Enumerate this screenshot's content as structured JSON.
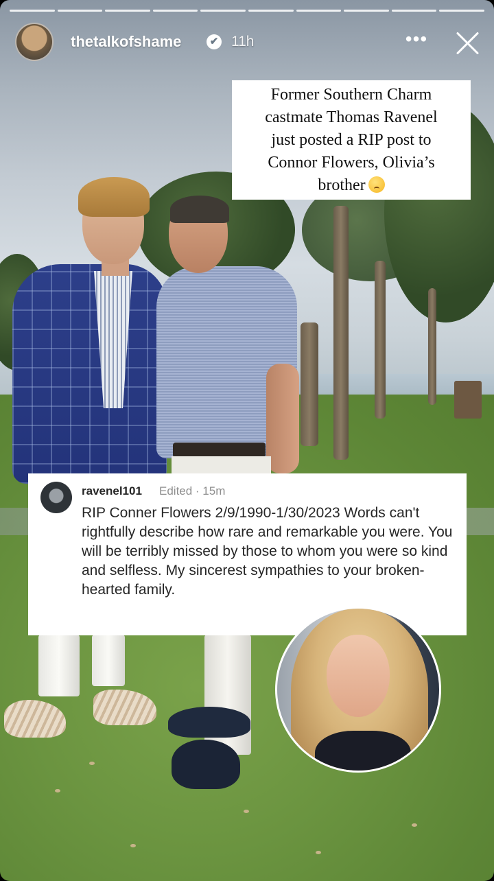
{
  "story": {
    "username": "thetalkofshame",
    "verified_badge": "✔",
    "time_ago": "11h",
    "more_label": "•••",
    "progress_segments": 10,
    "icons": [
      "profile-avatar-icon",
      "verified-badge-icon",
      "more-options-icon",
      "close-icon"
    ]
  },
  "caption": {
    "lines": [
      "Former Southern Charm",
      "castmate Thomas Ravenel",
      "just posted a RIP post to",
      "Connor Flowers, Olivia’s",
      "brother"
    ],
    "emoji": "sad-face-emoji"
  },
  "comment": {
    "username": "ravenel101",
    "meta": "Edited · 15m",
    "text": "RIP Conner Flowers 2/9/1990-1/30/2023 Words can't rightfully describe how rare and remarkable you were. You will be terribly missed by those to whom you were so kind and selfless. My sincerest sympathies to your broken-hearted family."
  },
  "colors": {
    "grass": "#6b9440",
    "sky": "#c4ccd4",
    "comment_bg": "#ffffff",
    "meta_text": "#8e8e8e"
  }
}
